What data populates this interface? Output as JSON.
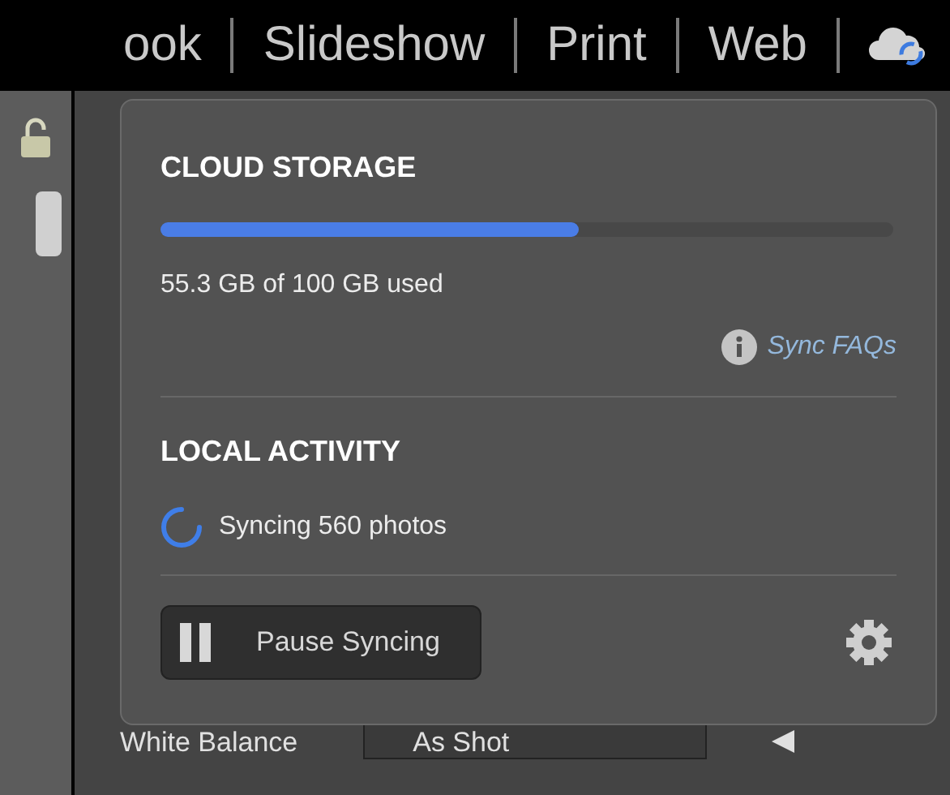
{
  "module_bar": {
    "items": [
      "ook",
      "Slideshow",
      "Print",
      "Web"
    ]
  },
  "develop_panel": {
    "white_balance": {
      "label": "White Balance",
      "value": "As Shot"
    }
  },
  "cloud_popup": {
    "cloud_storage": {
      "title": "CLOUD STORAGE",
      "level": 0.57,
      "usage": "55.3 GB of 100 GB used",
      "link": "Sync FAQs"
    },
    "local_activity": {
      "title": "LOCAL ACTIVITY",
      "status": "Syncing 560 photos"
    },
    "pause_button": "Pause Syncing"
  }
}
